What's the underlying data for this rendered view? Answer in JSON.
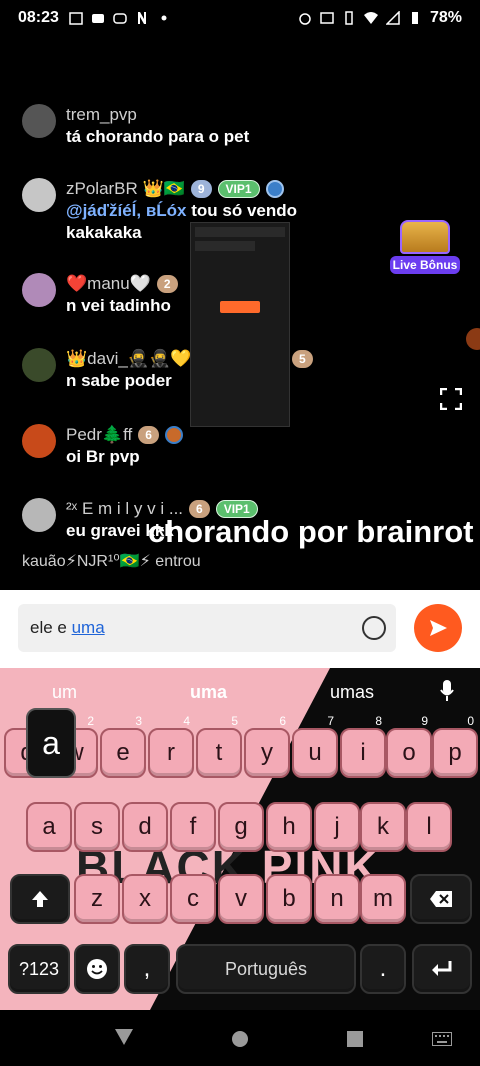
{
  "status_bar": {
    "time": "08:23",
    "battery": "78%"
  },
  "chat": [
    {
      "name": "trem_pvp",
      "text": "tá chorando para o pet",
      "avatar_color": "#555555"
    },
    {
      "name": "zPolarBR 👑🇧🇷",
      "badge_level": "9",
      "badge_vip": "VIP1",
      "mention": "@jáďžíéĺ, вĹóx",
      "text_after_mention": " tou só vendo",
      "text2": "kakakaka",
      "avatar_color": "#c6c6c6"
    },
    {
      "name": "❤️manu🤍",
      "badge_level": "2",
      "text": "n vei tadinho",
      "avatar_color": "#b08ab8"
    },
    {
      "name": "👑davi_🥷🥷💛king👑👑💛",
      "badge_level": "5",
      "text": "n sabe poder",
      "avatar_color": "#3a4a2a"
    },
    {
      "name": "Pedr🌲ff",
      "badge_level": "6",
      "text": "oi Br pvp",
      "avatar_color": "#c84a1a"
    },
    {
      "name": "²ˣ E m i  l y v i ...",
      "badge_level": "6",
      "badge_vip": "VIP1",
      "text": "eu gravei kkk",
      "avatar_color": "#b7b7b7"
    }
  ],
  "big_caption": "chorando por brainrot",
  "entered": {
    "user": "kauão⚡NJR¹⁰🇧🇷⚡",
    "action": "entrou"
  },
  "live_bonus": "Live Bônus",
  "input": {
    "typed_prefix": "ele e ",
    "typed_current": "uma"
  },
  "keyboard": {
    "suggestions": [
      "um",
      "uma",
      "umas"
    ],
    "row1": [
      {
        "k": "q",
        "h": "1"
      },
      {
        "k": "w",
        "h": "2"
      },
      {
        "k": "e",
        "h": "3"
      },
      {
        "k": "r",
        "h": "4"
      },
      {
        "k": "t",
        "h": "5"
      },
      {
        "k": "y",
        "h": "6"
      },
      {
        "k": "u",
        "h": "7"
      },
      {
        "k": "i",
        "h": "8"
      },
      {
        "k": "o",
        "h": "9"
      },
      {
        "k": "p",
        "h": "0"
      }
    ],
    "row2": [
      "a",
      "s",
      "d",
      "f",
      "g",
      "h",
      "j",
      "k",
      "l"
    ],
    "row3": [
      "z",
      "x",
      "c",
      "v",
      "b",
      "n",
      "m"
    ],
    "pressed_key": "a",
    "symbols_label": "?123",
    "comma": ",",
    "space_label": "Português",
    "period": ".",
    "background_text_dark": "BLACK",
    "background_text_pink": "PINK"
  },
  "colors": {
    "accent": "#ff5a1f",
    "key_pink": "#f3aab6",
    "mention": "#7fb2ff"
  }
}
